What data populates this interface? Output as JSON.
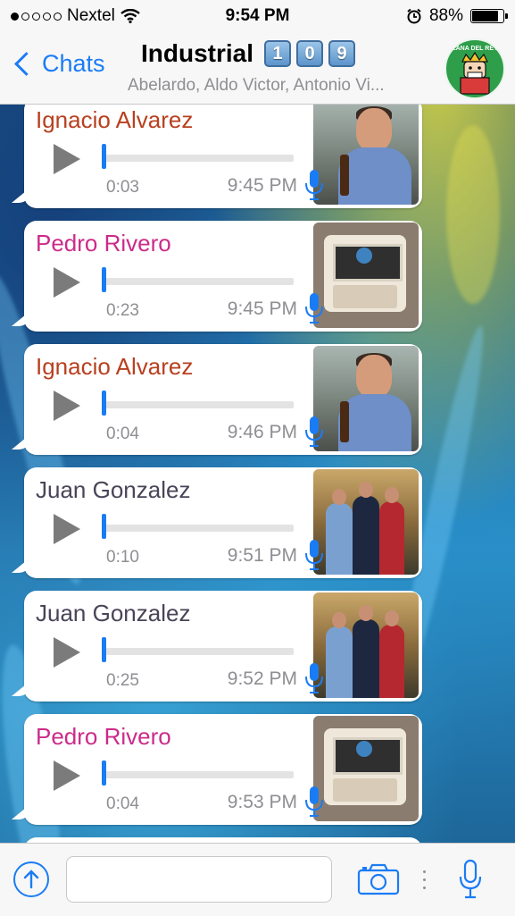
{
  "status_bar": {
    "carrier": "Nextel",
    "signal_bars_filled": 1,
    "signal_bars_total": 5,
    "time": "9:54 PM",
    "battery_percent": "88%",
    "battery_level": 0.88
  },
  "nav": {
    "back_label": "Chats",
    "group_name": "Industrial",
    "group_badges": [
      "1",
      "0",
      "9"
    ],
    "participants": "Abelardo, Aldo Victor, Antonio Vi...",
    "avatar_text": "LANA DEL REY"
  },
  "colors": {
    "accent": "#1a7cf5",
    "ignacio": "#b8401f",
    "pedro": "#cc2b8a",
    "juan": "#4a4458"
  },
  "messages": [
    {
      "sender": "Ignacio Alvarez",
      "duration": "0:03",
      "time": "9:45 PM",
      "photo": "ignacio",
      "progress": 0
    },
    {
      "sender": "Pedro Rivero",
      "duration": "0:23",
      "time": "9:45 PM",
      "photo": "pedro",
      "progress": 0
    },
    {
      "sender": "Ignacio Alvarez",
      "duration": "0:04",
      "time": "9:46 PM",
      "photo": "ignacio",
      "progress": 0
    },
    {
      "sender": "Juan Gonzalez",
      "duration": "0:10",
      "time": "9:51 PM",
      "photo": "juan",
      "progress": 0
    },
    {
      "sender": "Juan Gonzalez",
      "duration": "0:25",
      "time": "9:52 PM",
      "photo": "juan",
      "progress": 0
    },
    {
      "sender": "Pedro Rivero",
      "duration": "0:04",
      "time": "9:53 PM",
      "photo": "pedro",
      "progress": 0
    }
  ],
  "input": {
    "value": "",
    "placeholder": ""
  },
  "icons": {
    "share": "arrow-up-circle-icon",
    "camera": "camera-icon",
    "mic": "microphone-icon",
    "back": "chevron-left-icon",
    "wifi": "wifi-icon",
    "alarm": "alarm-clock-icon"
  }
}
